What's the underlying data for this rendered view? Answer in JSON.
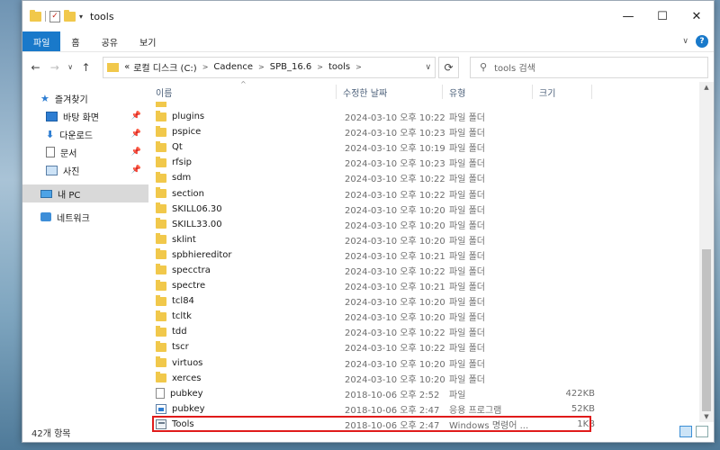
{
  "window": {
    "title": "tools"
  },
  "window_controls": {
    "minimize": "—",
    "maximize": "☐",
    "close": "✕"
  },
  "ribbon": {
    "tabs": [
      "파일",
      "홈",
      "공유",
      "보기"
    ],
    "collapse_glyph": "∨",
    "help_glyph": "?"
  },
  "address": {
    "overflow": "«",
    "crumbs": [
      "로컬 디스크 (C:)",
      "Cadence",
      "SPB_16.6",
      "tools"
    ]
  },
  "search": {
    "placeholder": "tools 검색"
  },
  "sidebar": {
    "quick_access": "즐겨찾기",
    "items": [
      {
        "label": "바탕 화면",
        "icon": "desktop-icon",
        "pinned": true
      },
      {
        "label": "다운로드",
        "icon": "download-icon",
        "pinned": true
      },
      {
        "label": "문서",
        "icon": "document-icon",
        "pinned": true
      },
      {
        "label": "사진",
        "icon": "picture-icon",
        "pinned": true
      }
    ],
    "this_pc": "내 PC",
    "network": "네트워크"
  },
  "columns": {
    "name": "이름",
    "date": "수정한 날짜",
    "type": "유형",
    "size": "크기"
  },
  "files": [
    {
      "name": "plugins",
      "date": "2024-03-10 오후 10:22",
      "type": "파일 폴더",
      "size": "",
      "kind": "folder"
    },
    {
      "name": "pspice",
      "date": "2024-03-10 오후 10:23",
      "type": "파일 폴더",
      "size": "",
      "kind": "folder"
    },
    {
      "name": "Qt",
      "date": "2024-03-10 오후 10:19",
      "type": "파일 폴더",
      "size": "",
      "kind": "folder"
    },
    {
      "name": "rfsip",
      "date": "2024-03-10 오후 10:23",
      "type": "파일 폴더",
      "size": "",
      "kind": "folder"
    },
    {
      "name": "sdm",
      "date": "2024-03-10 오후 10:22",
      "type": "파일 폴더",
      "size": "",
      "kind": "folder"
    },
    {
      "name": "section",
      "date": "2024-03-10 오후 10:22",
      "type": "파일 폴더",
      "size": "",
      "kind": "folder"
    },
    {
      "name": "SKILL06.30",
      "date": "2024-03-10 오후 10:20",
      "type": "파일 폴더",
      "size": "",
      "kind": "folder"
    },
    {
      "name": "SKILL33.00",
      "date": "2024-03-10 오후 10:20",
      "type": "파일 폴더",
      "size": "",
      "kind": "folder"
    },
    {
      "name": "sklint",
      "date": "2024-03-10 오후 10:20",
      "type": "파일 폴더",
      "size": "",
      "kind": "folder"
    },
    {
      "name": "spbhiereditor",
      "date": "2024-03-10 오후 10:21",
      "type": "파일 폴더",
      "size": "",
      "kind": "folder"
    },
    {
      "name": "specctra",
      "date": "2024-03-10 오후 10:22",
      "type": "파일 폴더",
      "size": "",
      "kind": "folder"
    },
    {
      "name": "spectre",
      "date": "2024-03-10 오후 10:21",
      "type": "파일 폴더",
      "size": "",
      "kind": "folder"
    },
    {
      "name": "tcl84",
      "date": "2024-03-10 오후 10:20",
      "type": "파일 폴더",
      "size": "",
      "kind": "folder"
    },
    {
      "name": "tcltk",
      "date": "2024-03-10 오후 10:20",
      "type": "파일 폴더",
      "size": "",
      "kind": "folder"
    },
    {
      "name": "tdd",
      "date": "2024-03-10 오후 10:22",
      "type": "파일 폴더",
      "size": "",
      "kind": "folder"
    },
    {
      "name": "tscr",
      "date": "2024-03-10 오후 10:22",
      "type": "파일 폴더",
      "size": "",
      "kind": "folder"
    },
    {
      "name": "virtuos",
      "date": "2024-03-10 오후 10:20",
      "type": "파일 폴더",
      "size": "",
      "kind": "folder"
    },
    {
      "name": "xerces",
      "date": "2024-03-10 오후 10:20",
      "type": "파일 폴더",
      "size": "",
      "kind": "folder"
    },
    {
      "name": "pubkey",
      "date": "2018-10-06 오후 2:52",
      "type": "파일",
      "size": "422KB",
      "kind": "file"
    },
    {
      "name": "pubkey",
      "date": "2018-10-06 오후 2:47",
      "type": "응용 프로그램",
      "size": "52KB",
      "kind": "exe"
    },
    {
      "name": "Tools",
      "date": "2018-10-06 오후 2:47",
      "type": "Windows 명령어 ...",
      "size": "1KB",
      "kind": "cmd",
      "highlighted": true
    }
  ],
  "status": {
    "count": "42개 항목"
  },
  "colors": {
    "accent": "#1979ca",
    "highlight": "#e01b1b",
    "folder": "#f1c84b"
  }
}
